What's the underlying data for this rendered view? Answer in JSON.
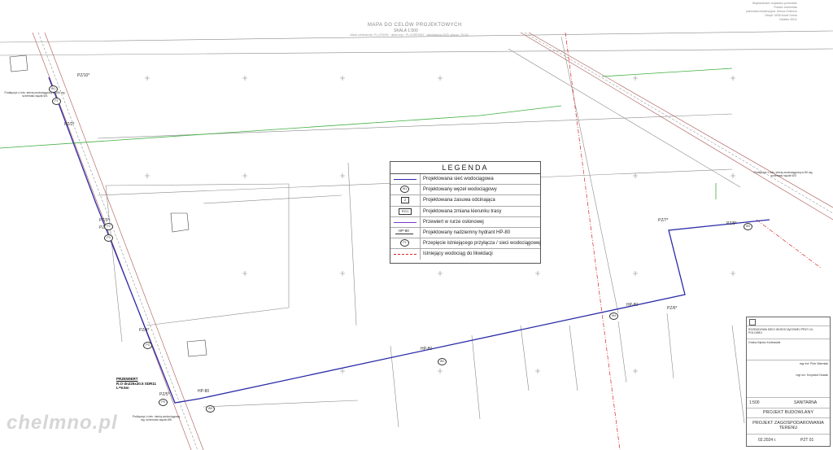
{
  "header": {
    "title": "MAPA DO CELÓW PROJEKTOWYCH",
    "scale": "SKALA 1:500",
    "note": "Układ odniesienia: PL-UTM/99 · układ wys.: PL-EVRF2007 · aktualizacja 2023, arkusz: 78-2/4"
  },
  "top_right_notes": [
    "Województwo: kujawsko-pomorskie",
    "Powiat: chełmiński",
    "jednostka ewidencyjna: Gmina Chełmno",
    "Obręb: 0008 Nowe Dobra",
    "Działka: 83/11"
  ],
  "legend": {
    "title": "LEGENDA",
    "items": [
      {
        "label": "Projektowana sieć wodociągowa",
        "sym": "line-blue"
      },
      {
        "label": "Projektowany węzeł wodociągowy",
        "sym": "W1"
      },
      {
        "label": "Projektowana zasuwa odcinająca",
        "sym": "Z"
      },
      {
        "label": "Projektowana zmiana kierunku trasy",
        "sym": "PZ/1"
      },
      {
        "label": "Przewiert w rurze osłonowej",
        "sym": "line-violet"
      },
      {
        "label": "Projektowany nadziemny hydrant HP-80",
        "sym": "HP-80"
      },
      {
        "label": "Przepięcie istniejącego przyłącza / sieci wodociągowej",
        "sym": "P1"
      },
      {
        "label": "Istniejący wodociąg do likwidacji",
        "sym": "line-red"
      }
    ]
  },
  "labels": {
    "pz10": "PZ/10*",
    "pz2": "PZ/2*",
    "pz3": "PZ/3*",
    "pz4": "PZ/4*",
    "pz5": "PZ/5*",
    "pz6": "PZ/6*",
    "pz7": "PZ/7*",
    "pz8": "PZ/8*",
    "pz9": "PZ/9*",
    "hp80a": "HP-80",
    "hp80b": "HP-80",
    "hp80c": "HP-80",
    "w1": "W1",
    "w2": "W2",
    "w3": "W3",
    "w4": "W4",
    "w5": "W5",
    "p1": "P1",
    "p2": "P2",
    "p3": "P3",
    "p4": "P4",
    "p5": "P5",
    "note_left": "Podłączyć z istn. siecią wodociągową w 150 wg. schematu węzła W1",
    "note_right": "Podłączyć z istn. siecią wodociągową w 80 wg. schematu węzła W3",
    "note_bottom": "Podłączyć z istn. siecią wodociągową wg. schematu węzła W5",
    "przewiert_title": "PRZEWIERT",
    "przewiert_l1": "R.O dn225x20.5 SDR11",
    "przewiert_l2": "L=9.5m"
  },
  "title_block": {
    "scale_label": "1:500",
    "branza": "SANITARNA",
    "stadium": "PROJEKT BUDOWLANY",
    "drawing_title": "PROJEKT ZAGOSPODAROWANIA TERENU",
    "date": "02.2024 r.",
    "sheet": "PZT 01",
    "designer1": "mgr inż. Piotr Warmiak",
    "designer2": "mgr inż. Krzysztof Nowak",
    "investor": "Gmina Kijewo Królewskie",
    "project_desc": "ROZBUDOWA SIECI WODOCIĄGOWEJ PRZY UL. POLOWEJ"
  },
  "watermark": "chelmno.pl",
  "colors": {
    "pipe": "#2a2aa8",
    "road": "#a55",
    "cadastre": "#888",
    "green": "#3fae3f",
    "red": "#d22"
  }
}
